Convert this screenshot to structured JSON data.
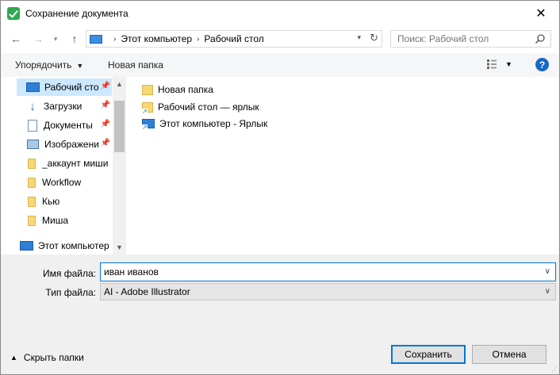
{
  "window": {
    "title": "Сохранение документа",
    "close_glyph": "✕"
  },
  "address": {
    "crumbs": [
      "Этот компьютер",
      "Рабочий стол"
    ],
    "search_placeholder": "Поиск: Рабочий стол"
  },
  "toolbar": {
    "organize_label": "Упорядочить",
    "new_folder_label": "Новая папка",
    "help_label": "?"
  },
  "nav": {
    "items": [
      {
        "label": "Рабочий сто",
        "icon": "desktop-icon",
        "pinned": true,
        "selected": true
      },
      {
        "label": "Загрузки",
        "icon": "downloads-icon",
        "pinned": true
      },
      {
        "label": "Документы",
        "icon": "documents-icon",
        "pinned": true
      },
      {
        "label": "Изображени",
        "icon": "pictures-icon",
        "pinned": true
      },
      {
        "label": "_аккаунт миши",
        "icon": "folder-icon"
      },
      {
        "label": "Workflow",
        "icon": "folder-icon"
      },
      {
        "label": "Кью",
        "icon": "folder-icon"
      },
      {
        "label": "Миша",
        "icon": "folder-icon"
      },
      {
        "label": "Этот компьютер",
        "icon": "computer-icon"
      }
    ]
  },
  "files": [
    {
      "name": "Новая папка",
      "icon": "folder-icon"
    },
    {
      "name": "Рабочий стол — ярлык",
      "icon": "folder-shortcut-icon"
    },
    {
      "name": "Этот компьютер - Ярлык",
      "icon": "computer-shortcut-icon"
    }
  ],
  "form": {
    "filename_label": "Имя файла:",
    "filename_value": "иван иванов",
    "filetype_label": "Тип файла:",
    "filetype_value": "AI - Adobe Illustrator"
  },
  "footer": {
    "hide_folders_label": "Скрыть папки",
    "save_label": "Сохранить",
    "cancel_label": "Отмена"
  },
  "colors": {
    "accent": "#0078d7",
    "selection": "#cce8ff",
    "help": "#1668c8"
  }
}
